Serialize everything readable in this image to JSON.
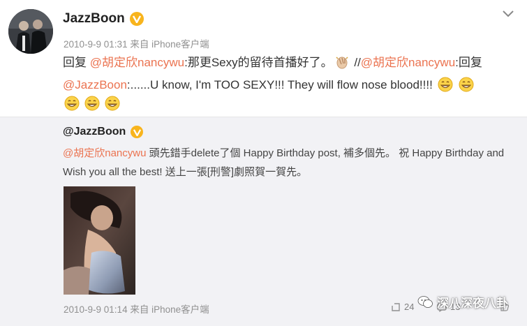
{
  "post": {
    "username": "JazzBoon",
    "meta": "2010-9-9 01:31 来自 iPhone客户端",
    "line1_reply": "回复 ",
    "line1_mention": "@胡定欣nancywu",
    "line1_text": ":那更Sexy的留待首播好了。",
    "line1_sep": " //",
    "line1_mention2": "@胡定欣nancywu",
    "line1_text2": ":回复",
    "line2_mention": "@JazzBoon",
    "line2_text": ":......U know, I'm TOO SEXY!!! They will flow nose blood!!!!"
  },
  "quoted": {
    "username": "@JazzBoon",
    "mention": "@胡定欣nancywu",
    "text": " 頭先錯手delete了個 Happy Birthday post, 補多個先。 祝 Happy Birthday and Wish you all the best! 送上一張[刑警]劇照賀一賀先。",
    "meta": "2010-9-9 01:14 来自 iPhone客户端",
    "repost_count": "24",
    "comment_count": "13"
  },
  "watermark": "深八深夜八卦",
  "icons": {
    "verified": "verified-v-icon",
    "chevron": "chevron-down-icon",
    "clap": "clap-emoji-icon",
    "grin": "grin-emoji-icon",
    "repost": "repost-icon",
    "comment": "comment-icon",
    "like": "like-icon"
  },
  "colors": {
    "mention": "#eb7350",
    "verified": "#f8b41d",
    "quote_bg": "#f2f2f5"
  }
}
